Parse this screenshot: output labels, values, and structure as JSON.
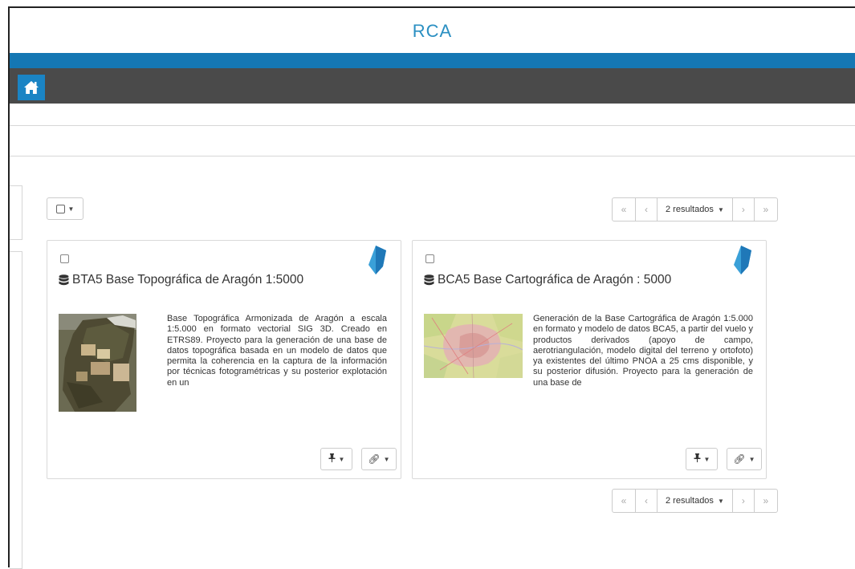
{
  "header": {
    "title": "RCA",
    "home_icon": "home-icon"
  },
  "colors": {
    "accent": "#1577b3",
    "title": "#2a8fc2",
    "nav": "#4a4a4a"
  },
  "toolbar": {
    "select_icon": "checkbox-icon"
  },
  "pagination_top": {
    "first": "«",
    "prev": "‹",
    "results": "2 resultados",
    "next": "›",
    "last": "»"
  },
  "pagination_bottom": {
    "first": "«",
    "prev": "‹",
    "results": "2 resultados",
    "next": "›",
    "last": "»"
  },
  "cards": [
    {
      "title": "BTA5 Base Topográfica de Aragón 1:5000",
      "description": "Base Topográfica Armonizada de Aragón a escala 1:5.000 en formato vectorial SIG 3D. Creado en ETRS89. Proyecto para la generación de una base de datos topográfica basada en un modelo de datos que permita la coherencia en la captura de la información por técnicas fotogramétricas y su posterior explotación en un",
      "thumbnail": "aerial-map-thumbnail",
      "pin_icon": "pin-icon",
      "link_icon": "link-icon"
    },
    {
      "title": "BCA5 Base Cartográfica de Aragón : 5000",
      "description": "Generación de la Base Cartográfica de Aragón 1:5.000 en formato y modelo de datos BCA5, a partir del vuelo y productos derivados (apoyo de campo, aerotriangulación, modelo digital del terreno y ortofoto) ya existentes del último PNOA a 25 cms disponible, y su posterior difusión. Proyecto para la generación de una base de",
      "thumbnail": "topographic-map-thumbnail",
      "pin_icon": "pin-icon",
      "link_icon": "link-icon"
    }
  ]
}
